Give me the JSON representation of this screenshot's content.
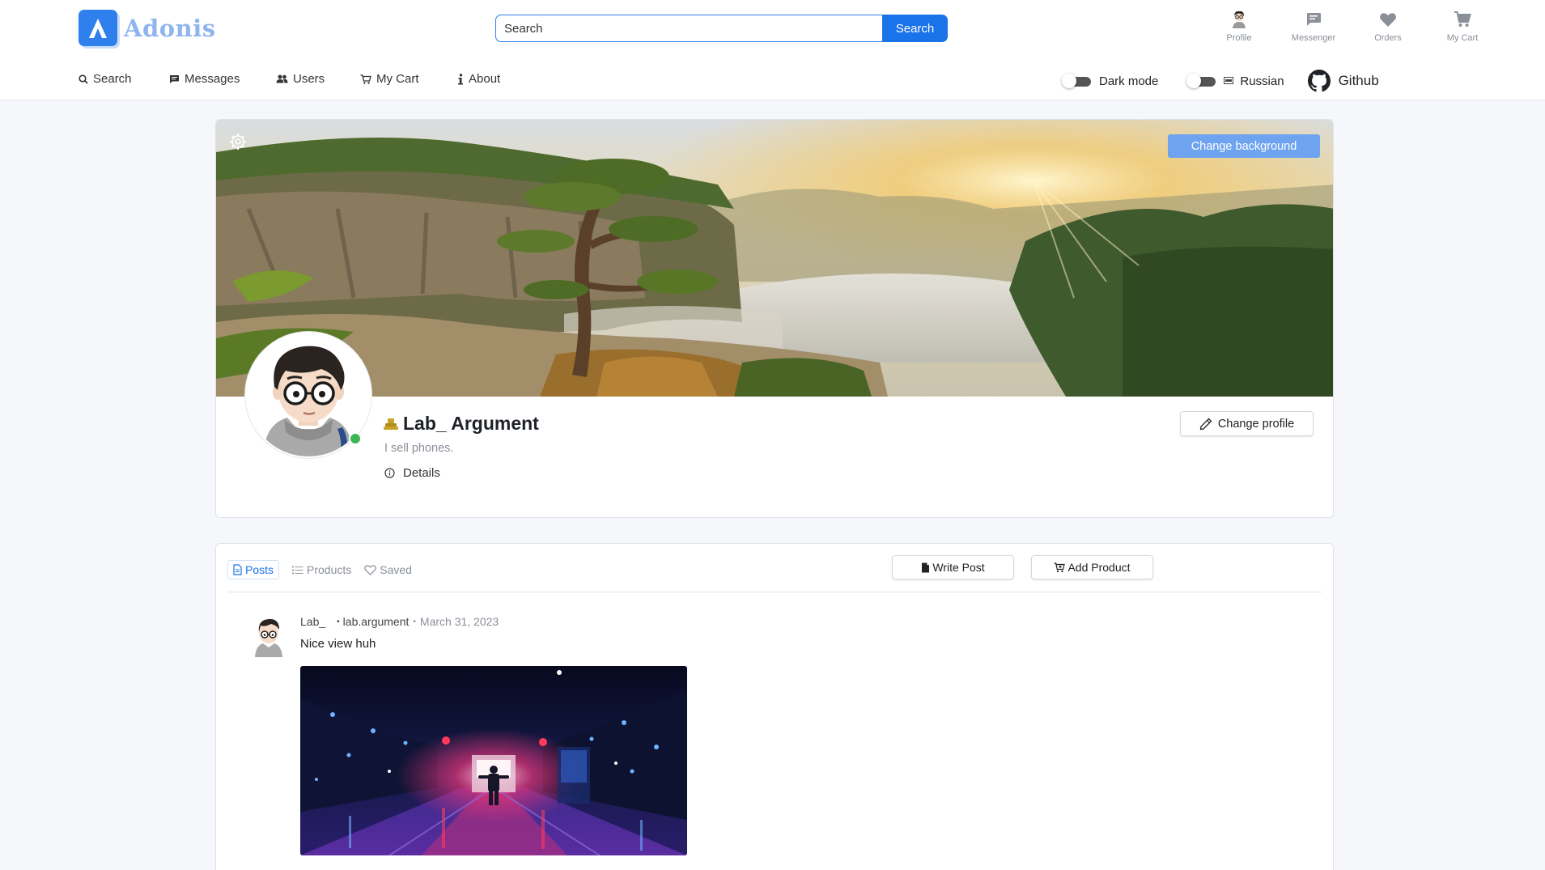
{
  "app": {
    "name": "Adonis",
    "logo_letter": "A",
    "accent": "#1a73e8"
  },
  "search": {
    "placeholder": "Search",
    "button_label": "Search"
  },
  "top_icons": [
    {
      "label": "Profile",
      "icon": "user-avatar-icon"
    },
    {
      "label": "Messenger",
      "icon": "chat-bubble-icon"
    },
    {
      "label": "Orders",
      "icon": "heart-icon"
    },
    {
      "label": "My Cart",
      "icon": "cart-icon"
    }
  ],
  "nav": [
    {
      "label": "Search",
      "icon": "search-icon"
    },
    {
      "label": "Messages",
      "icon": "message-icon"
    },
    {
      "label": "Users",
      "icon": "users-icon"
    },
    {
      "label": "My Cart",
      "icon": "cart-icon"
    },
    {
      "label": "About",
      "icon": "info-icon"
    }
  ],
  "toggles": {
    "dark_mode": {
      "label": "Dark mode",
      "on": false
    },
    "language": {
      "label": "Russian",
      "flag": "🇷🇺",
      "on": false
    }
  },
  "github_label": "Github",
  "profile": {
    "change_background_label": "Change background",
    "name": "Lab_ Argument",
    "bio": "I sell phones.",
    "details_label": "Details",
    "change_profile_label": "Change profile",
    "online": true,
    "online_color": "#3cb556"
  },
  "tabs": [
    {
      "label": "Posts",
      "icon": "document-icon",
      "active": true
    },
    {
      "label": "Products",
      "icon": "list-icon",
      "active": false
    },
    {
      "label": "Saved",
      "icon": "heart-outline-icon",
      "active": false
    }
  ],
  "actions": {
    "write_post": "Write Post",
    "add_product": "Add Product"
  },
  "posts": [
    {
      "author": "Lab_",
      "username": "lab.argument",
      "date": "March 31, 2023",
      "text": "Nice view huh"
    }
  ]
}
